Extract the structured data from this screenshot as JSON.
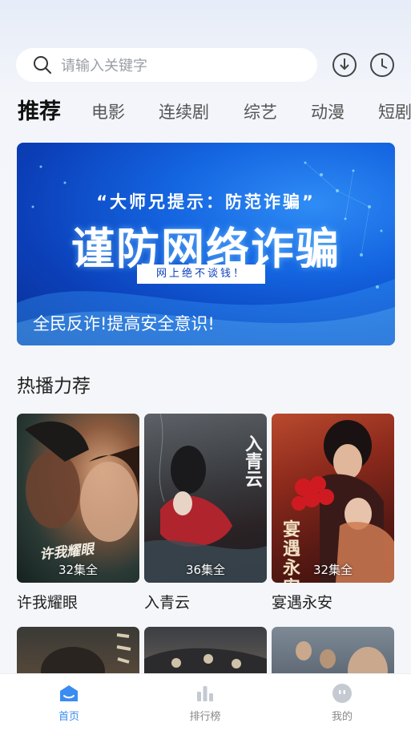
{
  "search": {
    "placeholder": "请输入关键字"
  },
  "header_icons": [
    "download-icon",
    "history-clock-icon"
  ],
  "tabs": [
    "推荐",
    "电影",
    "连续剧",
    "综艺",
    "动漫",
    "短剧"
  ],
  "banner": {
    "quote": "“大师兄提示：防范诈骗”",
    "headline": "谨防网络诈骗",
    "tag": "网上绝不谈钱！",
    "caption": "全民反诈!提高安全意识!"
  },
  "section": {
    "title": "热播力荐"
  },
  "cards": [
    {
      "title": "许我耀眼",
      "episodes": "32集全",
      "art": "许我耀眼"
    },
    {
      "title": "入青云",
      "episodes": "36集全",
      "art": "入青云"
    },
    {
      "title": "宴遇永安",
      "episodes": "32集全",
      "art": "宴遇永安"
    }
  ],
  "nav": {
    "items": [
      "首页",
      "排行榜",
      "我的"
    ],
    "active": "首页"
  },
  "colors": {
    "accent": "#3a8cf0",
    "banner": "#1464e0"
  }
}
